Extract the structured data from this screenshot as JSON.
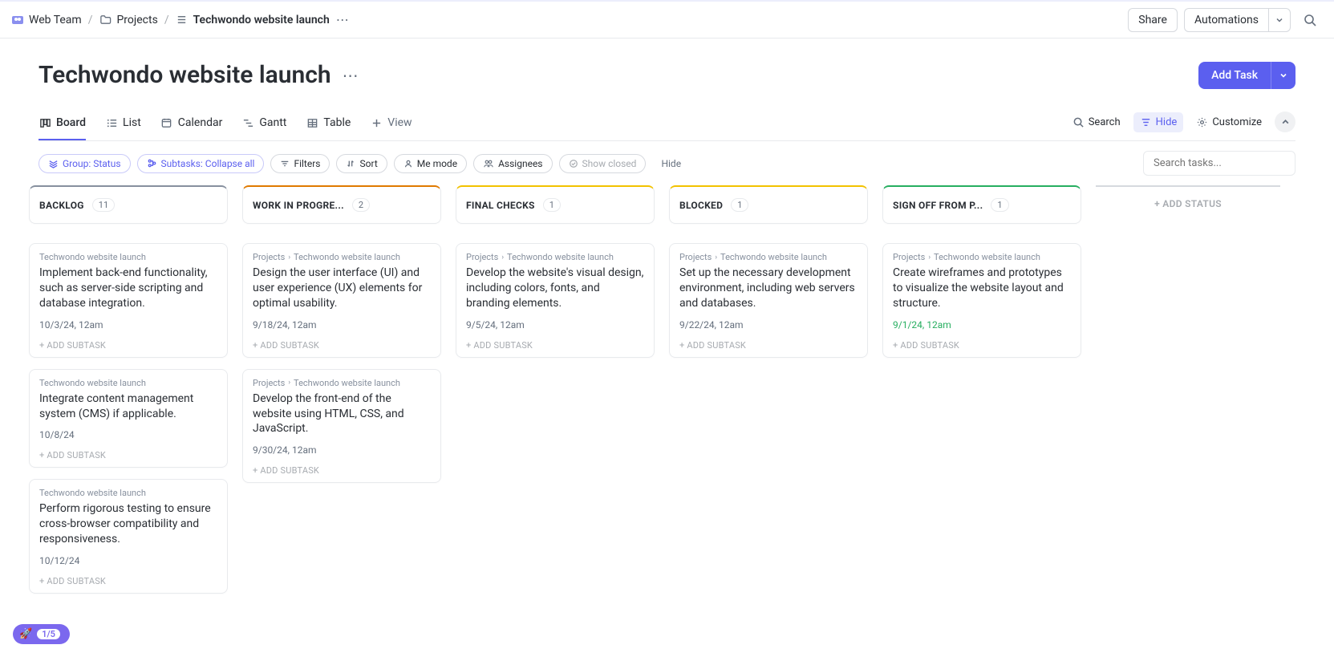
{
  "breadcrumb": {
    "team": "Web Team",
    "folder": "Projects",
    "list": "Techwondo website launch"
  },
  "topbar": {
    "share": "Share",
    "automations": "Automations"
  },
  "page": {
    "title": "Techwondo website launch"
  },
  "add_task": {
    "label": "Add Task"
  },
  "tabs": {
    "board": "Board",
    "list": "List",
    "calendar": "Calendar",
    "gantt": "Gantt",
    "table": "Table",
    "add_view": "View"
  },
  "tab_tools": {
    "search": "Search",
    "hide": "Hide",
    "customize": "Customize"
  },
  "chips": {
    "group": "Group: Status",
    "subtasks": "Subtasks: Collapse all",
    "filters": "Filters",
    "sort": "Sort",
    "me_mode": "Me mode",
    "assignees": "Assignees",
    "show_closed": "Show closed",
    "hide": "Hide"
  },
  "search_placeholder": "Search tasks...",
  "columns": [
    {
      "name": "BACKLOG",
      "count": "11",
      "color": "#87909e",
      "cards": [
        {
          "crumb1": "Techwondo website launch",
          "title": "Implement back-end functionality, such as server-side scripting and database integration.",
          "date": "10/3/24, 12am",
          "done": false
        },
        {
          "crumb1": "Techwondo website launch",
          "title": "Integrate content management system (CMS) if applicable.",
          "date": "10/8/24",
          "done": false
        },
        {
          "crumb1": "Techwondo website launch",
          "title": "Perform rigorous testing to ensure cross-browser compatibility and responsiveness.",
          "date": "10/12/24",
          "done": false
        }
      ]
    },
    {
      "name": "WORK IN PROGRE...",
      "count": "2",
      "color": "#e07a00",
      "cards": [
        {
          "crumb1": "Projects",
          "crumb2": "Techwondo website launch",
          "title": "Design the user interface (UI) and user experience (UX) elements for optimal usability.",
          "date": "9/18/24, 12am",
          "done": false
        },
        {
          "crumb1": "Projects",
          "crumb2": "Techwondo website launch",
          "title": "Develop the front-end of the website using HTML, CSS, and JavaScript.",
          "date": "9/30/24, 12am",
          "done": false
        }
      ]
    },
    {
      "name": "FINAL CHECKS",
      "count": "1",
      "color": "#f2c200",
      "cards": [
        {
          "crumb1": "Projects",
          "crumb2": "Techwondo website launch",
          "title": "Develop the website's visual design, including colors, fonts, and branding elements.",
          "date": "9/5/24, 12am",
          "done": false
        }
      ]
    },
    {
      "name": "BLOCKED",
      "count": "1",
      "color": "#f2c200",
      "cards": [
        {
          "crumb1": "Projects",
          "crumb2": "Techwondo website launch",
          "title": "Set up the necessary development environment, including web servers and databases.",
          "date": "9/22/24, 12am",
          "done": false
        }
      ]
    },
    {
      "name": "SIGN OFF FROM P...",
      "count": "1",
      "color": "#27ae60",
      "cards": [
        {
          "crumb1": "Projects",
          "crumb2": "Techwondo website launch",
          "title": "Create wireframes and prototypes to visualize the website layout and structure.",
          "date": "9/1/24, 12am",
          "done": true
        }
      ]
    }
  ],
  "add_status": "+ ADD STATUS",
  "add_subtask": "+ ADD SUBTASK",
  "onboarding": {
    "count": "1/5"
  }
}
